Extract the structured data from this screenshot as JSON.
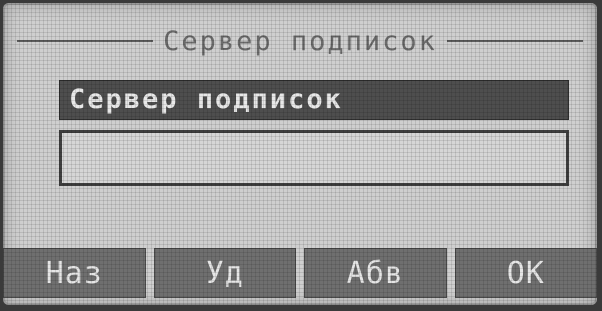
{
  "screen": {
    "title": "Сервер подписок",
    "field": {
      "label": "Сервер подписок",
      "value": ""
    }
  },
  "softkeys": [
    {
      "label": "Наз"
    },
    {
      "label": "Уд"
    },
    {
      "label": "Абв"
    },
    {
      "label": "OK"
    }
  ]
}
